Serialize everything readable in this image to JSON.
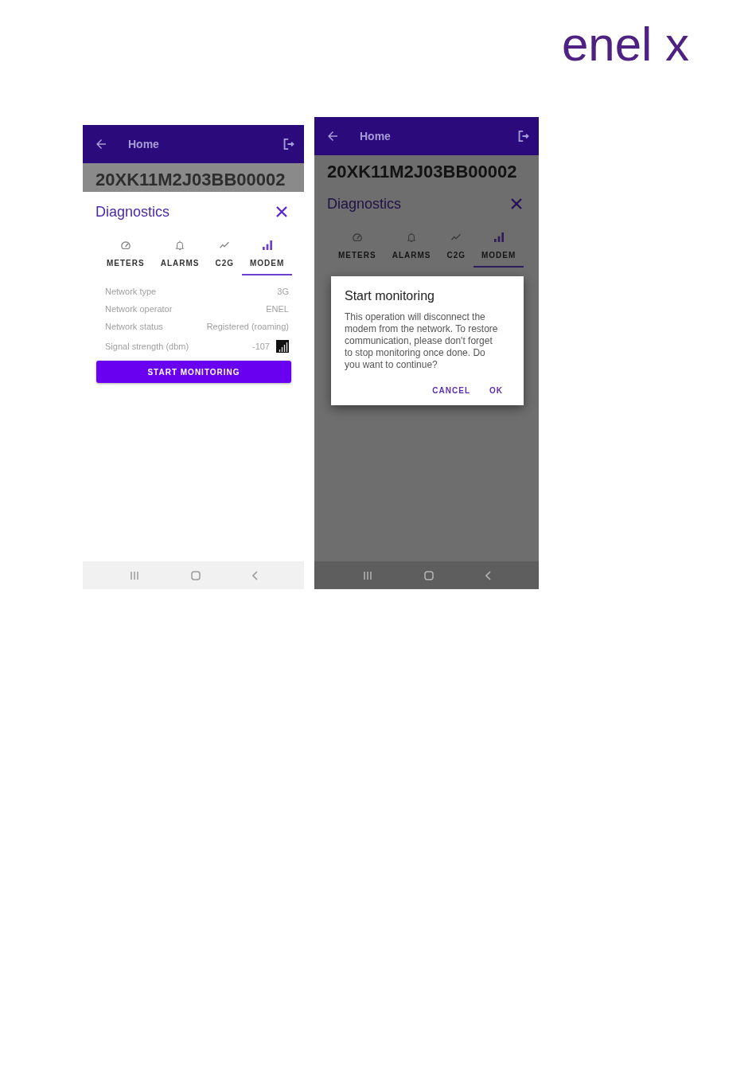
{
  "logo": "enel x",
  "screens": [
    {
      "kind": "sheet",
      "app_bar": {
        "title": "Home"
      },
      "device_id": "20XK11M2J03BB00002",
      "panel": {
        "title": "Diagnostics",
        "tabs": [
          {
            "label": "METERS",
            "selected": false
          },
          {
            "label": "ALARMS",
            "selected": false
          },
          {
            "label": "C2G",
            "selected": false
          },
          {
            "label": "MODEM",
            "selected": true
          }
        ],
        "rows": [
          {
            "kind": "text",
            "label": "Network type",
            "value": "3G"
          },
          {
            "kind": "text",
            "label": "Network operator",
            "value": "ENEL"
          },
          {
            "kind": "text",
            "label": "Network status",
            "value": "Registered (roaming)"
          },
          {
            "kind": "signal",
            "label": "Signal strength (dbm)",
            "value": "-107"
          }
        ],
        "button": "START MONITORING"
      }
    },
    {
      "kind": "dialog",
      "app_bar": {
        "title": "Home"
      },
      "device_id": "20XK11M2J03BB00002",
      "panel": {
        "title": "Diagnostics",
        "tabs": [
          {
            "label": "METERS",
            "selected": false
          },
          {
            "label": "ALARMS",
            "selected": false
          },
          {
            "label": "C2G",
            "selected": false
          },
          {
            "label": "MODEM",
            "selected": true
          }
        ]
      },
      "dialog": {
        "title": "Start monitoring",
        "message": "This operation will disconnect the modem from the network. To restore communication, please don't forget to stop monitoring once done. Do you want to continue?",
        "buttons": [
          "CANCEL",
          "OK"
        ]
      }
    }
  ]
}
